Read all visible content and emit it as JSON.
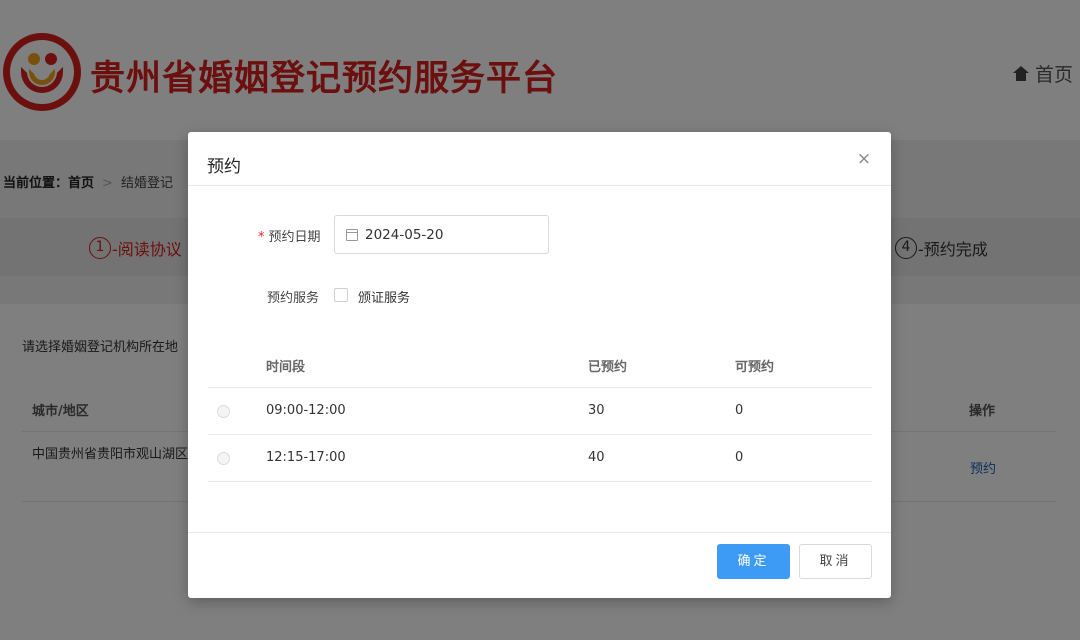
{
  "header": {
    "site_title": "贵州省婚姻登记预约服务平台",
    "nav_home": "首页"
  },
  "breadcrumb": {
    "label": "当前位置：",
    "home": "首页",
    "separator": ">",
    "current": "结婚登记"
  },
  "steps": [
    {
      "number": "1",
      "label": "-阅读协议",
      "color": "#d81e1e"
    },
    {
      "number": "4",
      "label": "-预约完成",
      "color": "#333333"
    }
  ],
  "content": {
    "prompt": "请选择婚姻登记机构所在地",
    "table": {
      "headers": {
        "city": "城市/地区",
        "action": "操作"
      },
      "rows": [
        {
          "city": "中国贵州省贵阳市观山湖区",
          "action": "预约"
        }
      ]
    }
  },
  "modal": {
    "title": "预约",
    "close_symbol": "×",
    "date_field": {
      "required_mark": "*",
      "label": "预约日期",
      "value": "2024-05-20"
    },
    "service_field": {
      "label": "预约服务",
      "option": "颁证服务",
      "checked": false
    },
    "slots": {
      "headers": {
        "time": "时间段",
        "booked": "已预约",
        "available": "可预约"
      },
      "rows": [
        {
          "time": "09:00-12:00",
          "booked": "30",
          "available": "0"
        },
        {
          "time": "12:15-17:00",
          "booked": "40",
          "available": "0"
        }
      ]
    },
    "buttons": {
      "confirm": "确定",
      "cancel": "取消"
    }
  },
  "colors": {
    "brand_red": "#d81e1e",
    "primary_blue": "#3d9bf6",
    "link_blue": "#1f5bb8",
    "required_red": "#f5222d"
  }
}
